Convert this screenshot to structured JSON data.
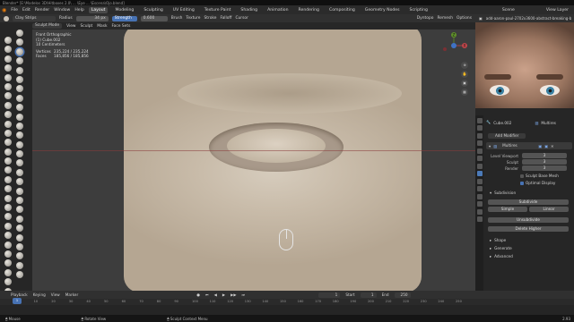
{
  "window": {
    "title": "Blender* [E:\\Modelos 3D\\Hitboxes 2.0\\ ... \\Eye ... \\Escena\\Ojo.blend]"
  },
  "menu": {
    "items": [
      "File",
      "Edit",
      "Render",
      "Window",
      "Help"
    ],
    "workspaces": [
      "Layout",
      "Modeling",
      "Sculpting",
      "UV Editing",
      "Texture Paint",
      "Shading",
      "Animation",
      "Rendering",
      "Compositing",
      "Geometry Nodes",
      "Scripting"
    ],
    "active_workspace": "Layout",
    "scene": "Scene",
    "view_layer": "View Layer"
  },
  "tool_header": {
    "brush": "Clay Strips",
    "radius_label": "Radius",
    "radius_value": "34 px",
    "strength_label": "Strength",
    "strength_value": "0.600",
    "menus": [
      "Brush",
      "Texture",
      "Stroke",
      "Falloff",
      "Cursor"
    ],
    "right": [
      "Dyntopo",
      "Remesh",
      "Options"
    ]
  },
  "mode_header": {
    "mode": "Sculpt Mode",
    "menus": [
      "View",
      "Sculpt",
      "Mask",
      "Face Sets"
    ]
  },
  "viewport": {
    "info": {
      "view": "Front Orthographic",
      "object": "(1) Cube.002",
      "units": "10 Centimeters",
      "vertices_label": "Vertices",
      "vertices": "235,224 / 235,224",
      "faces_label": "Faces",
      "faces": "185,856 / 185,856"
    },
    "gizmo_axes": [
      "X",
      "Y",
      "Z"
    ]
  },
  "reference": {
    "file": "add-aaron-paul-2702x3600-abstract-breaking-bad-hi..."
  },
  "properties": {
    "object": "Cube.002",
    "modifier_tab": "Multires",
    "add_modifier": "Add Modifier",
    "modifier_name": "Multires",
    "fields": [
      {
        "label": "Level Viewport",
        "value": "3"
      },
      {
        "label": "Sculpt",
        "value": "3"
      },
      {
        "label": "Render",
        "value": "3"
      }
    ],
    "checks": [
      {
        "label": "Sculpt Base Mesh",
        "on": false
      },
      {
        "label": "Optimal Display",
        "on": true
      }
    ],
    "subdivision_title": "Subdivision",
    "subdivide": "Subdivide",
    "simple": "Simple",
    "linear": "Linear",
    "unsubdivide": "Unsubdivide",
    "delete_higher": "Delete Higher",
    "sections": [
      "Shape",
      "Generate",
      "Advanced"
    ]
  },
  "timeline": {
    "menus": [
      "Playback",
      "Keying",
      "View",
      "Marker"
    ],
    "current_frame": "1",
    "start_label": "Start",
    "start": "1",
    "end_label": "End",
    "end": "250",
    "ticks": [
      "0",
      "10",
      "20",
      "30",
      "40",
      "50",
      "60",
      "70",
      "80",
      "90",
      "100",
      "110",
      "120",
      "130",
      "140",
      "150",
      "160",
      "170",
      "180",
      "190",
      "200",
      "210",
      "220",
      "230",
      "240",
      "250"
    ],
    "playhead": "1"
  },
  "status": {
    "items": [
      "Mouse",
      "Rotate View",
      "Sculpt Context Menu"
    ],
    "version": "2.93"
  }
}
